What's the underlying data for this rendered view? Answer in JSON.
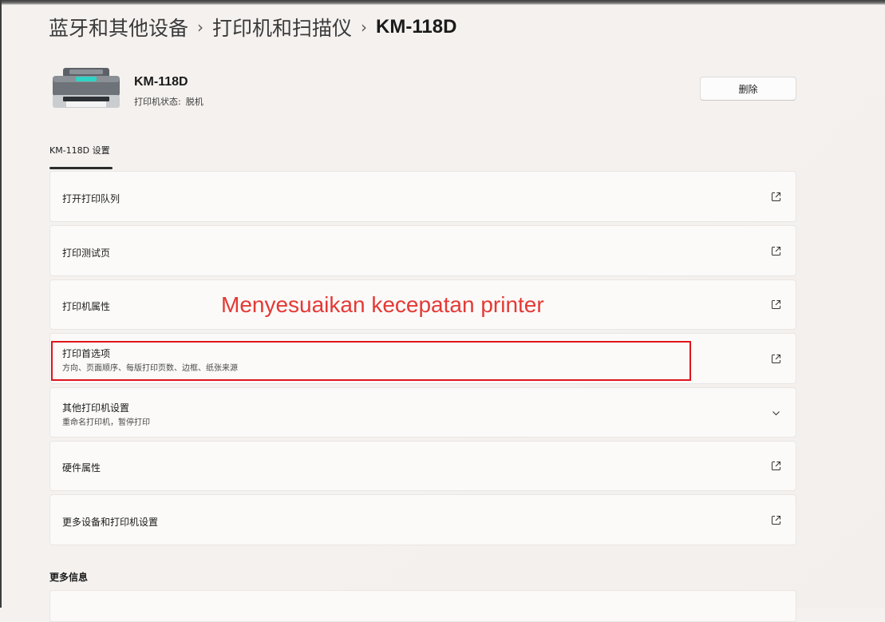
{
  "breadcrumb": {
    "items": [
      "蓝牙和其他设备",
      "打印机和扫描仪",
      "KM-118D"
    ],
    "separator": "›"
  },
  "device": {
    "name": "KM-118D",
    "status_label": "打印机状态:",
    "status_value": "脱机",
    "remove_label": "删除",
    "icon": "printer-icon"
  },
  "settings": {
    "heading": "KM-118D 设置",
    "items": [
      {
        "label": "打开打印队列",
        "trailing_icon": "open-external-icon"
      },
      {
        "label": "打印测试页",
        "trailing_icon": "open-external-icon"
      },
      {
        "label": "打印机属性",
        "trailing_icon": "open-external-icon"
      },
      {
        "label": "打印首选项",
        "description": "方向、页面顺序、每版打印页数、边框、纸张来源",
        "trailing_icon": "open-external-icon"
      },
      {
        "label": "其他打印机设置",
        "description": "重命名打印机，暂停打印",
        "trailing_icon": "chevron-down-icon"
      },
      {
        "label": "硬件属性",
        "trailing_icon": "open-external-icon"
      },
      {
        "label": "更多设备和打印机设置",
        "trailing_icon": "open-external-icon"
      }
    ]
  },
  "annotation": {
    "text": "Menyesuaikan kecepatan printer",
    "color": "#e53935"
  },
  "more_info": {
    "heading": "更多信息"
  },
  "colors": {
    "annotation_box": "#e0141d",
    "background": "#f4f1ef",
    "card": "#fbfaf9"
  }
}
